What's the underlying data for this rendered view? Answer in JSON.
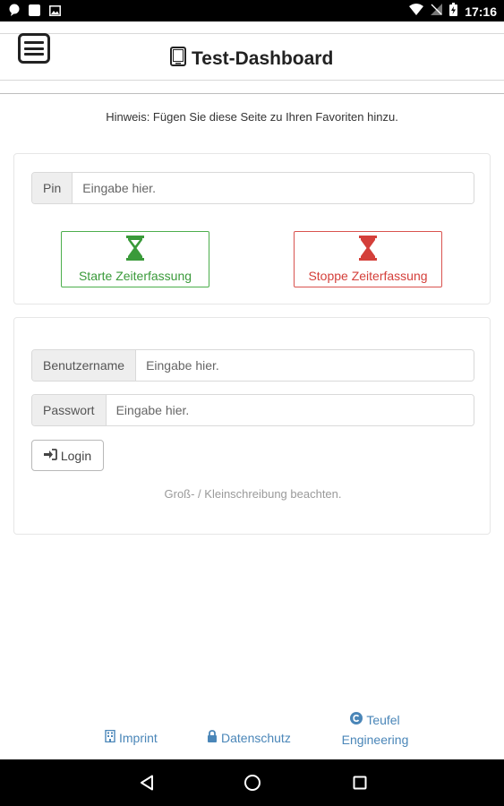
{
  "status_bar": {
    "time": "17:16"
  },
  "header": {
    "title": "Test-Dashboard",
    "menu_icon": "hamburger-menu-icon",
    "title_icon": "tablet-icon"
  },
  "hint": "Hinweis: Fügen Sie diese Seite zu Ihren Favoriten hinzu.",
  "pin_panel": {
    "pin_label": "Pin",
    "pin_placeholder": "Eingabe hier.",
    "start_label": "Starte Zeiterfassung",
    "stop_label": "Stoppe Zeiterfassung",
    "start_color": "#3a9a3a",
    "stop_color": "#d43f3a"
  },
  "login_panel": {
    "username_label": "Benutzername",
    "username_placeholder": "Eingabe hier.",
    "password_label": "Passwort",
    "password_placeholder": "Eingabe hier.",
    "login_label": "Login",
    "case_note": "Groß- / Kleinschreibung beachten."
  },
  "footer": {
    "imprint": "Imprint",
    "privacy": "Datenschutz",
    "teufel_line1": "Teufel",
    "teufel_line2": "Engineering",
    "link_color": "#4a86b8"
  }
}
